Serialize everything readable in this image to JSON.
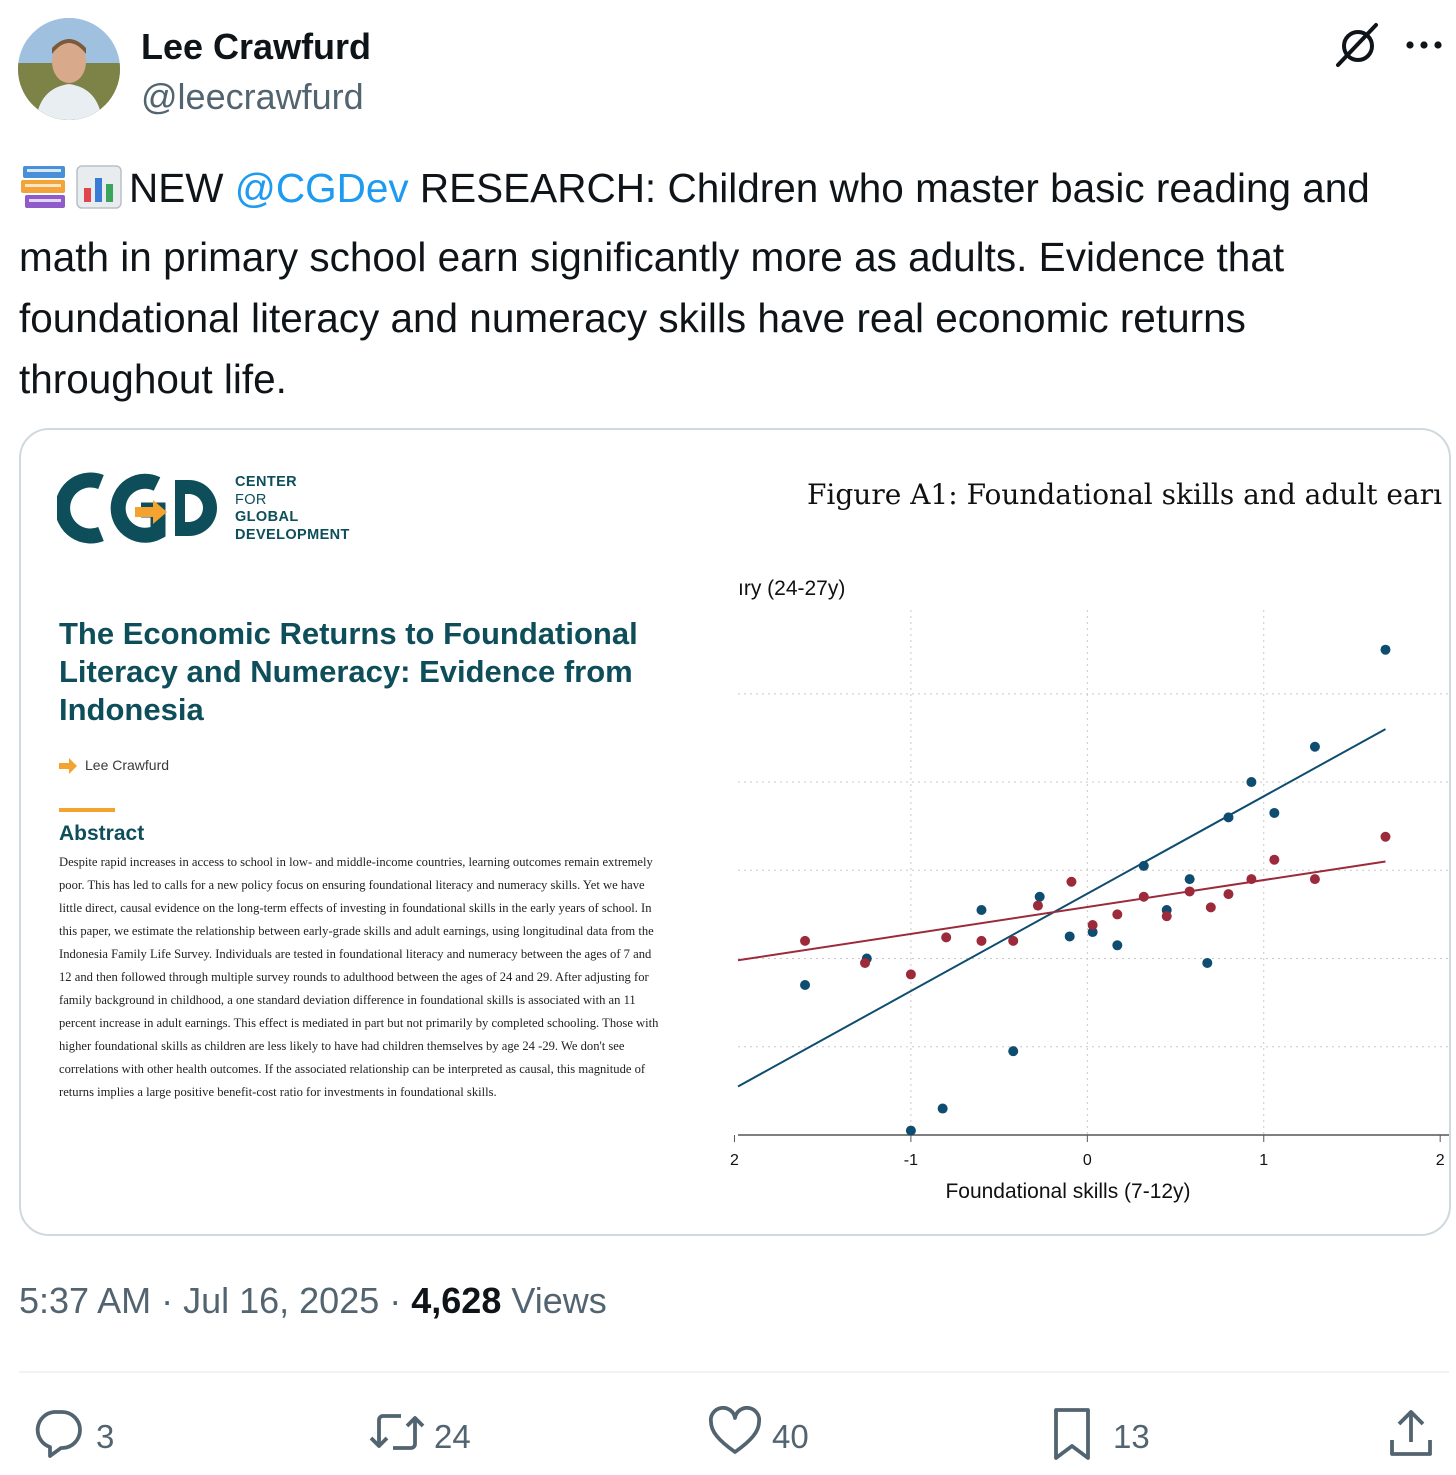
{
  "author": {
    "display_name": "Lee Crawfurd",
    "handle": "@leecrawfurd"
  },
  "tweet": {
    "emoji": [
      "books-emoji",
      "bar-chart-emoji"
    ],
    "text_before_mention": "NEW ",
    "mention": "@CGDev",
    "text_after_mention": " RESEARCH: Children who master basic reading and math in primary school earn significantly more as adults. Evidence that foundational literacy and numeracy skills have real economic returns throughout life."
  },
  "media": {
    "org_lines": [
      "CENTER",
      "FOR",
      "GLOBAL",
      "DEVELOPMENT"
    ],
    "logo_text": "CGD",
    "paper_title": "The Economic Returns to Foundational Literacy and Numeracy: Evidence from Indonesia",
    "paper_author": "Lee Crawfurd",
    "abstract_heading": "Abstract",
    "abstract_text": "Despite rapid increases in access to school in low- and middle-income countries, learning outcomes remain extremely poor. This has led to calls for a new policy focus on ensuring foundational literacy and numeracy skills. Yet we have little direct, causal evidence on the long-term effects of investing in foundational skills in the early years of school. In this paper, we estimate the relationship between early-grade skills and adult earnings, using longitudinal data from the Indonesia Family Life Survey. Individuals are tested in foundational literacy and numeracy between the ages of 7 and 12 and then followed through multiple survey rounds to adulthood between the ages of 24 and 29. After adjusting for family background in childhood, a one standard deviation difference in foundational skills is associated with an 11 percent increase in adult earnings. This effect is mediated in part but not primarily by completed schooling. Those with higher foundational skills as children are less likely to have had children themselves by age 24 -29. We don't see correlations with other health outcomes. If the associated relationship can be interpreted as causal, this magnitude of returns implies a large positive benefit-cost ratio for investments in foundational skills.",
    "figure_title": "Figure A1: Foundational skills and adult earı"
  },
  "chart_data": {
    "type": "scatter",
    "title": "Figure A1: Foundational skills and adult earı",
    "panel_label": "ıry (24-27y)",
    "xlabel": "Foundational skills (7-12y)",
    "xticks": [
      "2",
      "-1",
      "0",
      "1",
      "2"
    ],
    "xlim": [
      -1.98,
      2.05
    ],
    "ylim": [
      0,
      5.95
    ],
    "grid": true,
    "series": [
      {
        "color": "#0e4c70",
        "points": [
          [
            -1.6,
            1.7
          ],
          [
            -1.25,
            2.0
          ],
          [
            -0.6,
            2.55
          ],
          [
            -0.27,
            2.7
          ],
          [
            -1.0,
            0.05
          ],
          [
            -0.82,
            0.3
          ],
          [
            -0.42,
            0.95
          ],
          [
            -0.1,
            2.25
          ],
          [
            0.03,
            2.3
          ],
          [
            0.17,
            2.15
          ],
          [
            0.32,
            3.05
          ],
          [
            0.45,
            2.55
          ],
          [
            0.58,
            2.9
          ],
          [
            0.68,
            1.95
          ],
          [
            0.8,
            3.6
          ],
          [
            0.93,
            4.0
          ],
          [
            1.06,
            3.65
          ],
          [
            1.29,
            4.4
          ],
          [
            1.69,
            5.5
          ]
        ],
        "trend": [
          [
            -1.98,
            0.55
          ],
          [
            1.69,
            4.6
          ]
        ]
      },
      {
        "color": "#9c2a3a",
        "points": [
          [
            -1.6,
            2.2
          ],
          [
            -1.26,
            1.95
          ],
          [
            -1.0,
            1.82
          ],
          [
            -0.8,
            2.24
          ],
          [
            -0.6,
            2.2
          ],
          [
            -0.42,
            2.2
          ],
          [
            -0.28,
            2.6
          ],
          [
            -0.09,
            2.87
          ],
          [
            0.03,
            2.38
          ],
          [
            0.17,
            2.5
          ],
          [
            0.32,
            2.7
          ],
          [
            0.45,
            2.48
          ],
          [
            0.58,
            2.76
          ],
          [
            0.7,
            2.58
          ],
          [
            0.8,
            2.73
          ],
          [
            0.93,
            2.9
          ],
          [
            1.06,
            3.12
          ],
          [
            1.29,
            2.9
          ],
          [
            1.69,
            3.38
          ]
        ],
        "trend": [
          [
            -1.98,
            1.98
          ],
          [
            1.69,
            3.1
          ]
        ]
      }
    ]
  },
  "meta": {
    "time": "5:37 AM",
    "separator": " · ",
    "date": "Jul 16, 2025",
    "views_count": "4,628",
    "views_label": " Views"
  },
  "actions": {
    "replies": "3",
    "reposts": "24",
    "likes": "40",
    "bookmarks": "13"
  },
  "icons": [
    "grok-icon",
    "more-icon",
    "reply-icon",
    "repost-icon",
    "like-icon",
    "bookmark-icon",
    "share-icon"
  ],
  "colors": {
    "link": "#1d9bf0",
    "secondary_text": "#536471",
    "cgd_teal": "#0d4e5a",
    "cgd_orange": "#f4a230",
    "series_blue": "#0e4c70",
    "series_red": "#9c2a3a"
  }
}
